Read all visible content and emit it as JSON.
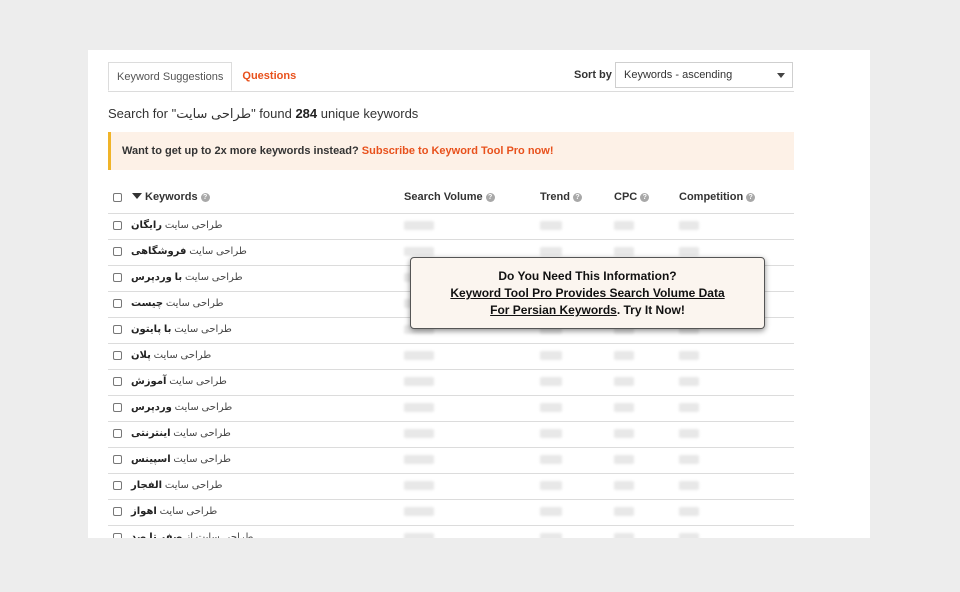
{
  "tabs": [
    {
      "label": "Keyword Suggestions",
      "active": true
    },
    {
      "label": "Questions",
      "active": false
    }
  ],
  "sort": {
    "label": "Sort by",
    "value": "Keywords - ascending"
  },
  "summary": {
    "prefix": "Search for \"",
    "query": "طراحی سایت",
    "middle": "\" found ",
    "count": "284",
    "suffix": " unique keywords"
  },
  "promo": {
    "text": "Want to get up to 2x more keywords instead? ",
    "link": "Subscribe to Keyword Tool Pro now!"
  },
  "table": {
    "headers": {
      "keywords": "Keywords",
      "search_volume": "Search Volume",
      "trend": "Trend",
      "cpc": "CPC",
      "competition": "Competition"
    },
    "rows": [
      {
        "base": "طراحی سایت ",
        "bold": "رایگان"
      },
      {
        "base": "طراحی سایت ",
        "bold": "فروشگاهی"
      },
      {
        "base": "طراحی سایت ",
        "bold": "با وردپرس"
      },
      {
        "base": "طراحی سایت ",
        "bold": "چیست"
      },
      {
        "base": "طراحی سایت ",
        "bold": "با پایتون"
      },
      {
        "base": "طراحی سایت ",
        "bold": "پلان"
      },
      {
        "base": "طراحی سایت ",
        "bold": "آموزش"
      },
      {
        "base": "طراحی سایت ",
        "bold": "وردپرس"
      },
      {
        "base": "طراحی سایت ",
        "bold": "اینترنتی"
      },
      {
        "base": "طراحی سایت ",
        "bold": "اسپینس"
      },
      {
        "base": "طراحی سایت ",
        "bold": "الفجار"
      },
      {
        "base": "طراحی سایت ",
        "bold": "اهواز"
      },
      {
        "base": "طراحی سایت از ",
        "bold": "صفر تا صد"
      }
    ]
  },
  "popup": {
    "title": "Do You Need This Information?",
    "link": "Keyword Tool Pro Provides Search Volume Data For Persian Keywords",
    "tail": ". Try It Now!"
  },
  "colors": {
    "accent": "#e8511c",
    "promo_bg": "#fdf1e7",
    "promo_border": "#f0b429"
  }
}
